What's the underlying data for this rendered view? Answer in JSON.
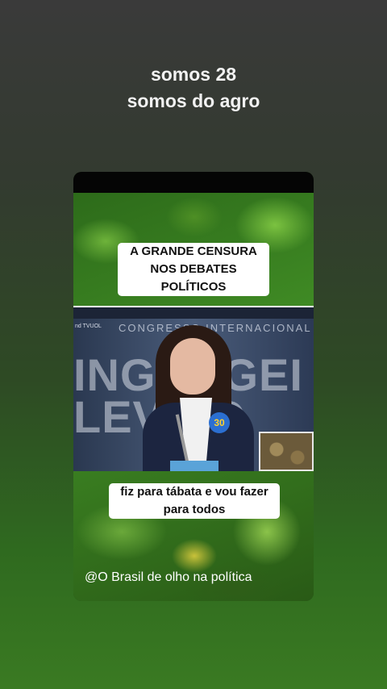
{
  "header": {
    "line1": "somos 28",
    "line2": "somos do agro"
  },
  "post": {
    "caption_top": [
      "A GRANDE CENSURA",
      "NOS DEBATES",
      "POLÍTICOS"
    ],
    "caption_bottom": [
      "fiz para tábata e vou fazer",
      "para todos"
    ],
    "watermark": "@O Brasil de olho na política"
  },
  "video": {
    "small_label": "nd TVUOL",
    "congress_text": "CONGRESSO INTERNACIONAL",
    "big_text_line1": "INGUAGEI",
    "big_text_line2": "LEVIDO",
    "badge_number": "30"
  }
}
